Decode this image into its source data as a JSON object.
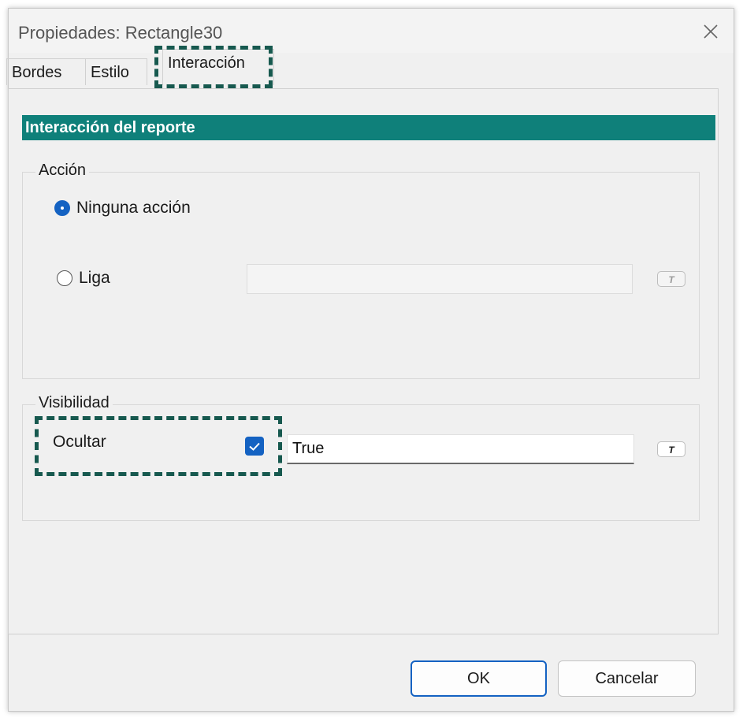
{
  "window": {
    "title": "Propiedades: Rectangle30"
  },
  "tabs": [
    {
      "label": "Bordes"
    },
    {
      "label": "Estilo"
    },
    {
      "label": "Interacción",
      "selected": true
    }
  ],
  "section_header": "Interacción del reporte",
  "accion": {
    "label": "Acción",
    "options": [
      {
        "label": "Ninguna acción",
        "selected": true
      },
      {
        "label": "Liga",
        "selected": false
      }
    ],
    "liga_value": "",
    "expr_button": "T"
  },
  "visibilidad": {
    "label": "Visibilidad",
    "ocultar_label": "Ocultar",
    "ocultar_checked": true,
    "value": "True",
    "expr_button": "T"
  },
  "buttons": {
    "ok": "OK",
    "cancel": "Cancelar"
  },
  "colors": {
    "accent": "#1462c2",
    "header_bg": "#0f807a",
    "highlight": "#17594f"
  }
}
